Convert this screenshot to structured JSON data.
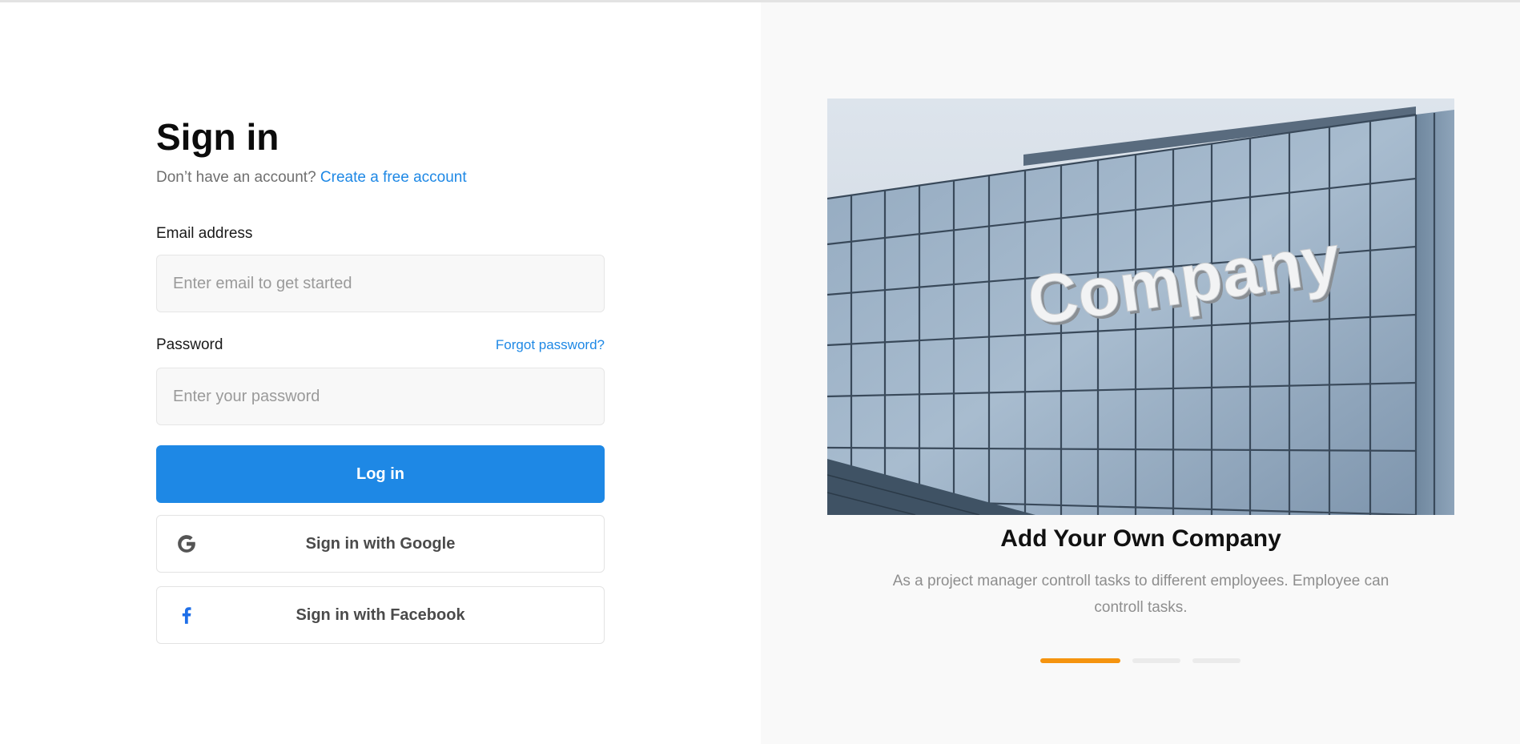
{
  "signin": {
    "title": "Sign in",
    "no_account_text": "Don’t have an account?",
    "create_account_link": "Create a free account",
    "email_label": "Email address",
    "email_placeholder": "Enter email to get started",
    "email_value": "",
    "password_label": "Password",
    "forgot_password_link": "Forgot password?",
    "password_placeholder": "Enter your password",
    "password_value": "",
    "login_button": "Log in",
    "google_button": "Sign in with Google",
    "facebook_button": "Sign in with Facebook"
  },
  "carousel": {
    "image_sign_text": "Company",
    "slide_title": "Add Your Own Company",
    "slide_description": "As a project manager controll tasks to different employees. Employee can controll tasks.",
    "slide_count": 3,
    "active_slide_index": 0
  },
  "colors": {
    "primary": "#1e88e5",
    "accent_indicator": "#f5940f",
    "inactive_indicator": "#ebebeb",
    "facebook_icon": "#1e6fe8",
    "google_icon": "#555555",
    "right_panel_bg": "#f9f9f9",
    "input_bg": "#f8f8f8"
  },
  "icons": {
    "google": "google-g-icon",
    "facebook": "facebook-f-icon"
  }
}
